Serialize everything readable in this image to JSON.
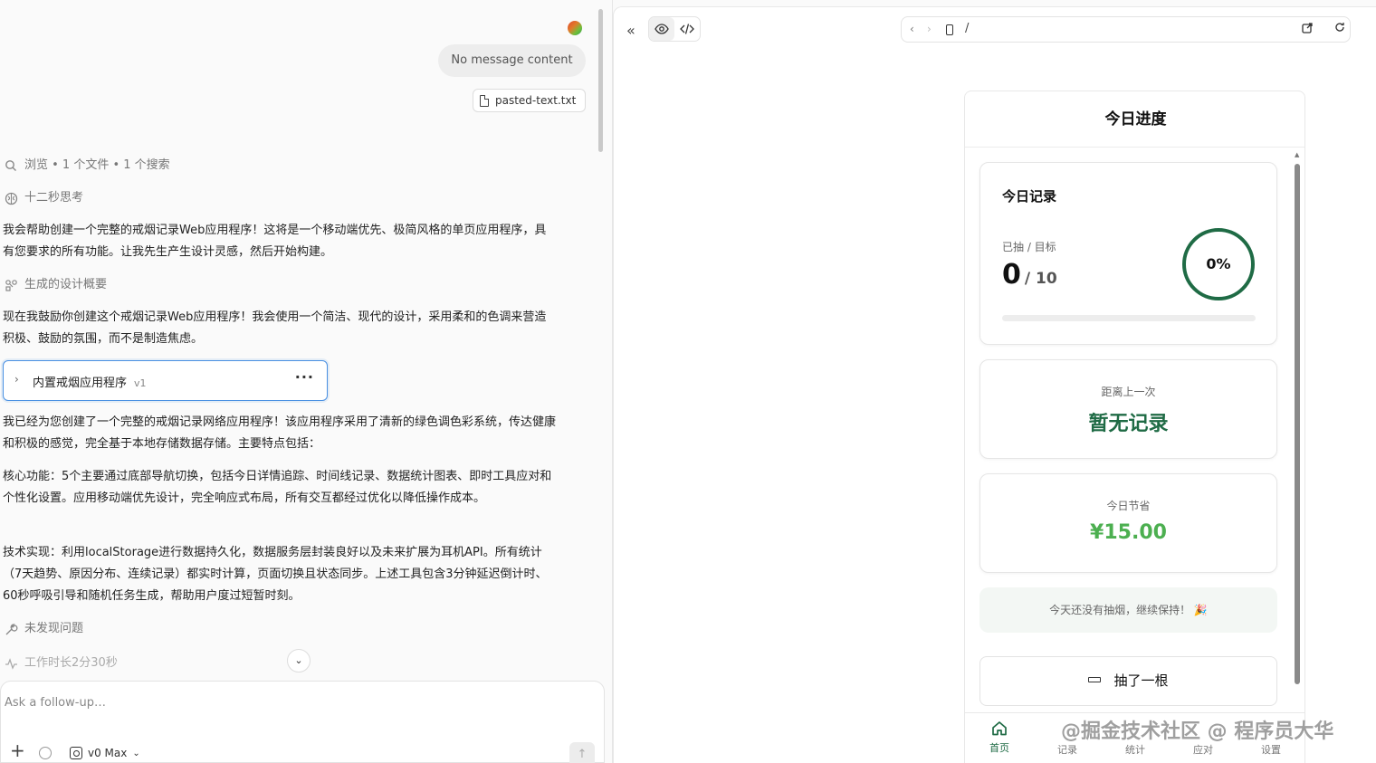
{
  "chat": {
    "user_message": "No message content",
    "attachment": "pasted-text.txt",
    "steps": {
      "browse": "浏览 • 1 个文件 • 1 个搜索",
      "thinking": "十二秒思考",
      "design": "生成的设计概要",
      "no_issues": "未发现问题",
      "work_time": "工作时长2分30秒"
    },
    "paragraphs": [
      "我会帮助创建一个完整的戒烟记录Web应用程序！这将是一个移动端优先、极简风格的单页应用程序，具有您要求的所有功能。让我先生产生设计灵感，然后开始构建。",
      "现在我鼓励你创建这个戒烟记录Web应用程序！我会使用一个简洁、现代的设计，采用柔和的色调来营造积极、鼓励的氛围，而不是制造焦虑。",
      "我已经为您创建了一个完整的戒烟记录网络应用程序！该应用程序采用了清新的绿色调色彩系统，传达健康和积极的感觉，完全基于本地存储数据存储。主要特点包括：",
      "核心功能：5个主要通过底部导航切换，包括今日详情追踪、时间线记录、数据统计图表、即时工具应对和个性化设置。应用移动端优先设计，完全响应式布局，所有交互都经过优化以降低操作成本。",
      "技术实现：利用localStorage进行数据持久化，数据服务层封装良好以及未来扩展为耳机API。所有统计（7天趋势、原因分布、连续记录）都实时计算，页面切换且状态同步。上述工具包含3分钟延迟倒计时、60秒呼吸引导和随机任务生成，帮助用户度过短暂时刻。"
    ],
    "artifact": {
      "title": "内置戒烟应用程序",
      "version": "v1"
    }
  },
  "composer": {
    "placeholder": "Ask a follow-up…",
    "model": "v0 Max"
  },
  "preview": {
    "url_path": "/"
  },
  "app": {
    "header_title": "今日进度",
    "today_card": {
      "title": "今日记录",
      "label": "已抽 / 目标",
      "count": "0",
      "goal": "/ 10",
      "percent": "0%",
      "progress": 0
    },
    "since_last": {
      "label": "距离上一次",
      "value": "暂无记录"
    },
    "savings": {
      "label": "今日节省",
      "value": "¥15.00"
    },
    "note": "今天还没有抽烟，继续保持！ 🎉",
    "smoke_button": "抽了一根",
    "tabs": [
      "首页",
      "记录",
      "统计",
      "应对",
      "设置"
    ]
  },
  "watermark": "@掘金技术社区 @ 程序员大华",
  "colors": {
    "brand_green": "#1f6b45",
    "money_green": "#4caf50",
    "selection_blue": "#4a90e2"
  }
}
